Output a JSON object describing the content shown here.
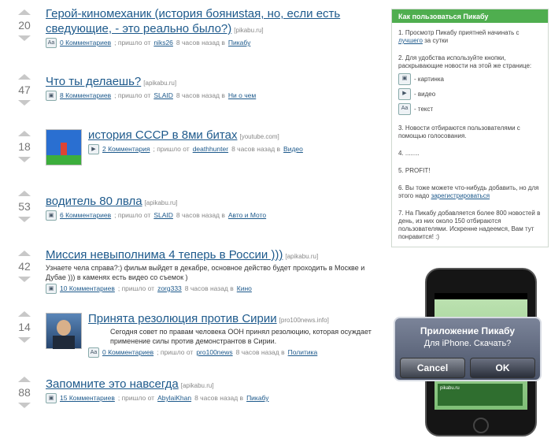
{
  "stories": [
    {
      "score": "20",
      "title": "Герой-киномеханик (история бояниstaя, но, если есть сведующие, - это реально было?)",
      "source": "[pikabu.ru]",
      "type_icon": "text-icon",
      "comments": "0 Комментариев",
      "posted_prefix": "; пришло от",
      "author": "niks26",
      "time": "8 часов назад в",
      "category": "Пикабу"
    },
    {
      "score": "47",
      "title": "Что ты делаешь?",
      "source": "[apikabu.ru]",
      "type_icon": "picture-icon",
      "comments": "8 Комментариев",
      "posted_prefix": "; пришло от",
      "author": "SLAID",
      "time": "8 часов назад в",
      "category": "Ни о чем"
    },
    {
      "score": "18",
      "title": "история СССР в 8ми битах",
      "source": "[youtube.com]",
      "type_icon": "video-icon",
      "comments": "2 Комментария",
      "posted_prefix": "; пришло от",
      "author": "deathhunter",
      "time": "8 часов назад в",
      "category": "Видео"
    },
    {
      "score": "53",
      "title": "водитель 80 лвла",
      "source": "[apikabu.ru]",
      "type_icon": "picture-icon",
      "comments": "6 Комментариев",
      "posted_prefix": "; пришло от",
      "author": "SLAID",
      "time": "8 часов назад в",
      "category": "Авто и Мото"
    },
    {
      "score": "42",
      "title": "Миссия невыполнима 4 теперь в России )))",
      "source": "[apikabu.ru]",
      "description": "Узнаете чела справа?:) фильм выйдет в декабре, основное действо будет проходить в Москве и Дубае ))) в каменях есть видео со съемок )",
      "type_icon": "picture-icon",
      "comments": "10 Комментариев",
      "posted_prefix": "; пришло от",
      "author": "zorg333",
      "time": "8 часов назад в",
      "category": "Кино"
    },
    {
      "score": "14",
      "title": "Принята резолюция против Сирии",
      "source": "[pro100news.info]",
      "description": "Сегодня совет по правам человека ООН принял резолюцию, которая осуждает применение силы против демонстрантов в Сирии.",
      "type_icon": "text-icon",
      "comments": "0 Комментариев",
      "posted_prefix": "; пришло от",
      "author": "pro100news",
      "time": "8 часов назад в",
      "category": "Политика"
    },
    {
      "score": "88",
      "title": "Запомните это навсегда",
      "source": "[apikabu.ru]",
      "type_icon": "picture-icon",
      "comments": "15 Комментариев",
      "posted_prefix": "; пришло от",
      "author": "AbylaiKhan",
      "time": "8 часов назад в",
      "category": "Пикабу"
    }
  ],
  "sidebar": {
    "heading": "Как пользоваться Пикабу",
    "p1_before": "1. Просмотр Пикабу приятней начинать с",
    "p1_link": "лучшего",
    "p1_after": "за сутки",
    "p2": "2. Для удобства используйте кнопки, раскрывающие новости на этой же странице:",
    "legend": [
      "- картинка",
      "- видео",
      "- текст"
    ],
    "p3": "3. Новости отбираются пользователями с помощью голосования.",
    "p4": "4. ........",
    "p5": "5. PROFIT!",
    "p6_before": "6. Вы тоже можете что-нибудь добавить, но для этого надо",
    "p6_link": "зарегистрироваться",
    "p7": "7. На Пикабу добавляется более 800 новостей в день, из них около 150 отбираются пользователями. Искренне надеемся, Вам тут понравится! :)"
  },
  "promo": {
    "phone_site_text": "pikabu.ru",
    "dialog_title": "Приложение Пикабу",
    "dialog_message": "Для iPhone. Скачать?",
    "cancel_label": "Cancel",
    "ok_label": "OK"
  },
  "colors": {
    "link": "#1e5a8c",
    "sidebar_header": "#4fae4f"
  }
}
